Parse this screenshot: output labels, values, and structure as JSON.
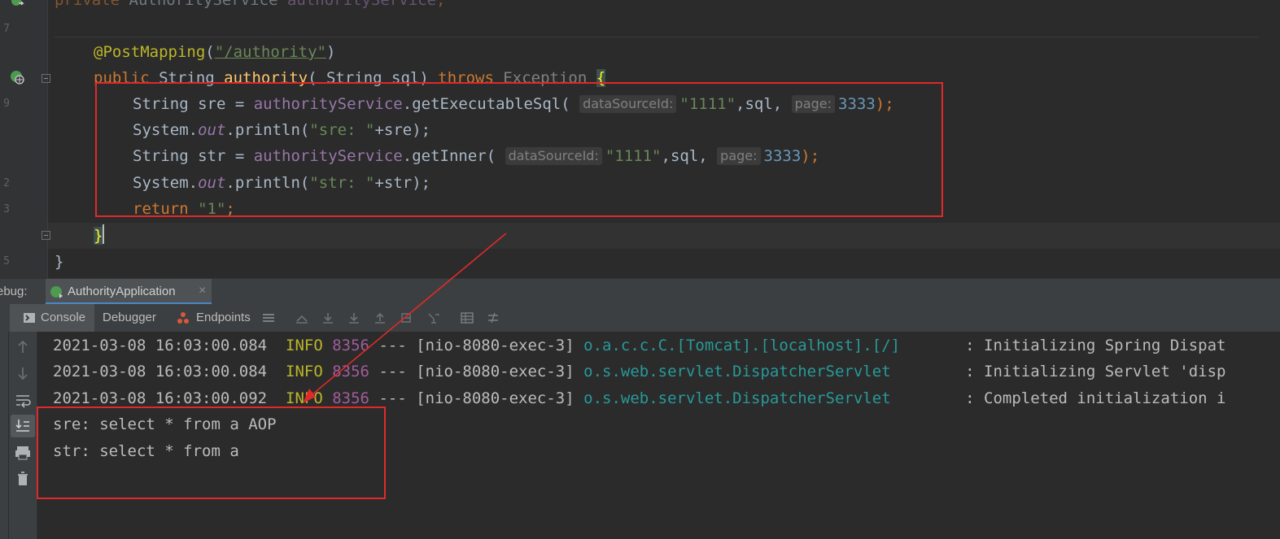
{
  "editor": {
    "lines": {
      "field": [
        "private ",
        "AuthorityService ",
        "authorityService",
        ";"
      ],
      "mapping_annotation": "@PostMapping",
      "mapping_path": "\"/authority\"",
      "sig_public": "public ",
      "sig_type": "String ",
      "sig_name": "authority",
      "sig_params": "( String sql) ",
      "sig_throws": "throws ",
      "sig_exception": "Exception ",
      "sig_brace": "{",
      "l1_prefix": "String sre = ",
      "l1_obj": "authorityService",
      "l1_method": ".getExecutableSql(",
      "l1_hint1": "dataSourceId:",
      "l1_arg1": "\"1111\"",
      "l1_mid": ",sql,",
      "l1_hint2": "page:",
      "l1_arg2": "3333",
      "l1_end": ");",
      "l2_sys": "System.",
      "l2_out": "out",
      "l2_call": ".println(",
      "l2_str": "\"sre: \"",
      "l2_rest": "+sre);",
      "l3_prefix": "String str = ",
      "l3_obj": "authorityService",
      "l3_method": ".getInner(",
      "l3_hint1": "dataSourceId:",
      "l3_arg1": "\"1111\"",
      "l3_mid": ",sql,",
      "l3_hint2": "page:",
      "l3_arg2": "3333",
      "l3_end": ");",
      "l4_sys": "System.",
      "l4_out": "out",
      "l4_call": ".println(",
      "l4_str": "\"str: \"",
      "l4_rest": "+str);",
      "l5_return": "return ",
      "l5_str": "\"1\"",
      "l5_end": ";",
      "close_method": "}",
      "close_class": "}"
    }
  },
  "debug": {
    "label": "ebug:",
    "tab_label": "AuthorityApplication",
    "tab_close": "×"
  },
  "toolbar": {
    "console": "Console",
    "debugger": "Debugger",
    "endpoints": "Endpoints"
  },
  "console": {
    "logs": [
      {
        "ts": "2021-03-08 16:03:00.084",
        "level": "INFO",
        "pid": "8356",
        "sep": "---",
        "thread": "[nio-8080-exec-3]",
        "logger": "o.a.c.c.C.[Tomcat].[localhost].[/]",
        "msg": ": Initializing Spring Dispat"
      },
      {
        "ts": "2021-03-08 16:03:00.084",
        "level": "INFO",
        "pid": "8356",
        "sep": "---",
        "thread": "[nio-8080-exec-3]",
        "logger": "o.s.web.servlet.DispatcherServlet",
        "msg": ": Initializing Servlet 'disp"
      },
      {
        "ts": "2021-03-08 16:03:00.092",
        "level": "INFO",
        "pid": "8356",
        "sep": "---",
        "thread": "[nio-8080-exec-3]",
        "logger": "o.s.web.servlet.DispatcherServlet",
        "msg": ": Completed initialization i"
      }
    ],
    "output": [
      "sre: select * from a AOP",
      "str: select * from a"
    ]
  },
  "colors": {
    "annotation_red": "#e02a2a",
    "background": "#2b2b2b"
  }
}
